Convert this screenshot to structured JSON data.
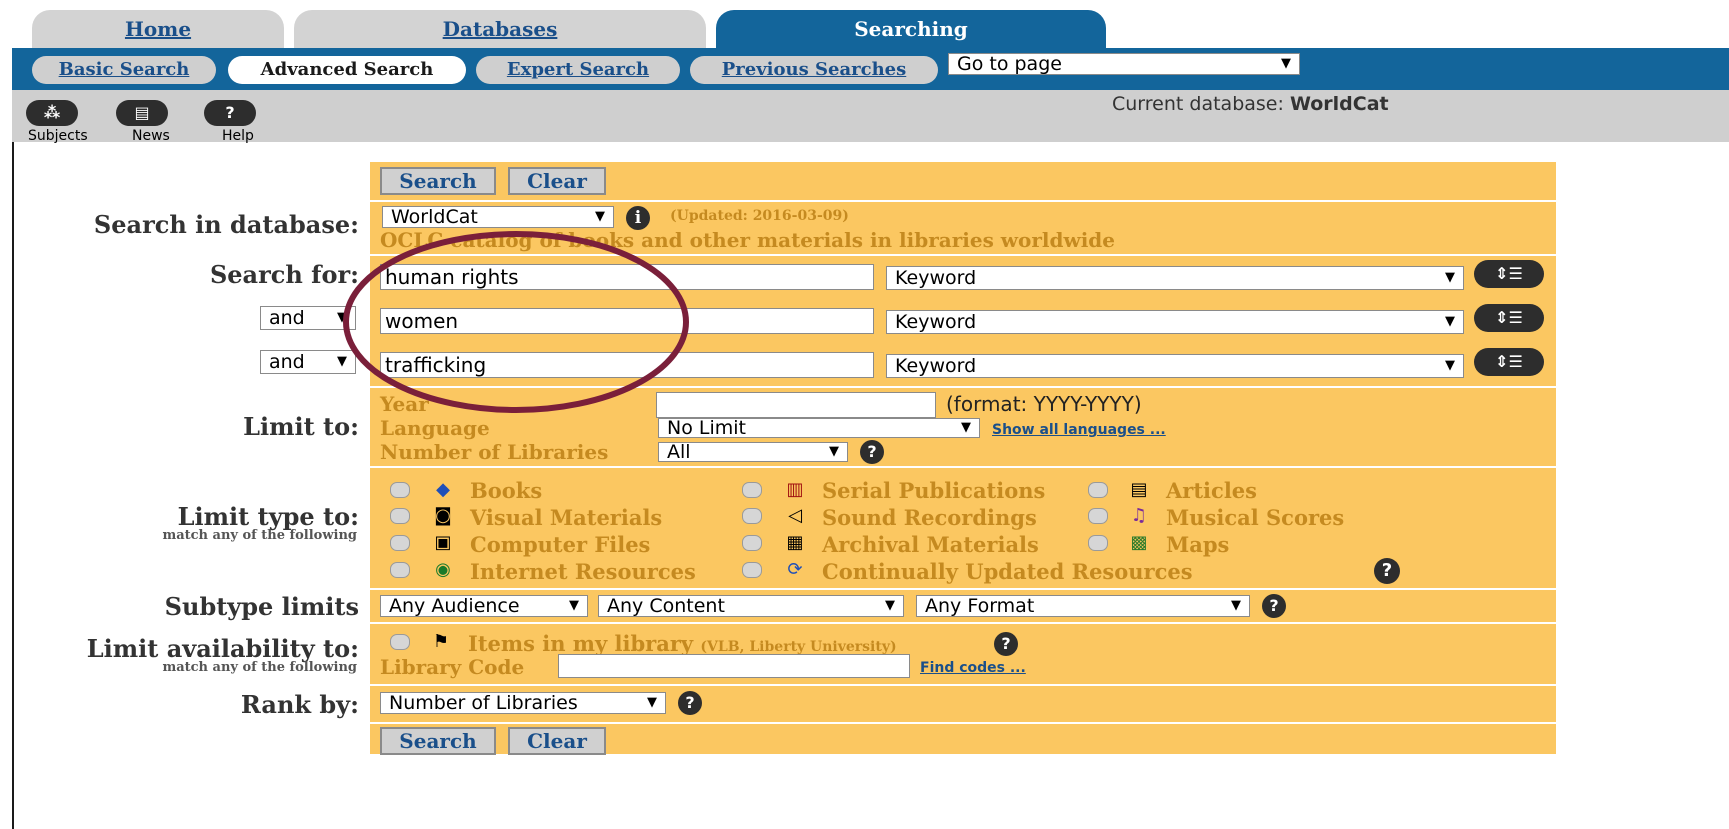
{
  "tabs": {
    "home": "Home",
    "databases": "Databases",
    "searching": "Searching"
  },
  "subtabs": {
    "basic": "Basic Search",
    "advanced": "Advanced Search",
    "expert": "Expert Search",
    "previous": "Previous Searches"
  },
  "goto_page": "Go to page",
  "toolbar": {
    "subjects": "Subjects",
    "news": "News",
    "help": "Help",
    "current_db_label": "Current database:",
    "current_db": "WorldCat"
  },
  "buttons": {
    "search": "Search",
    "clear": "Clear"
  },
  "labels": {
    "search_in_database": "Search in database:",
    "search_for": "Search for:",
    "limit_to": "Limit to:",
    "limit_type_to": "Limit type to:",
    "match_any": "match any of the following",
    "subtype_limits": "Subtype limits",
    "limit_availability_to": "Limit availability to:",
    "rank_by": "Rank by:"
  },
  "database": {
    "selected": "WorldCat",
    "updated": "(Updated: 2016-03-09)",
    "description": "OCLC catalog of books and other materials in libraries worldwide"
  },
  "search_rows": [
    {
      "operator": "",
      "term": "human rights",
      "index": "Keyword"
    },
    {
      "operator": "and",
      "term": "women",
      "index": "Keyword"
    },
    {
      "operator": "and",
      "term": "trafficking",
      "index": "Keyword"
    }
  ],
  "limits": {
    "year_label": "Year",
    "year_value": "",
    "year_format": "(format: YYYY-YYYY)",
    "language_label": "Language",
    "language_value": "No Limit",
    "show_all_languages": "Show all languages ...",
    "num_libraries_label": "Number of Libraries",
    "num_libraries_value": "All"
  },
  "types": [
    {
      "label": "Books",
      "icon": "book-icon"
    },
    {
      "label": "Serial Publications",
      "icon": "serial-icon"
    },
    {
      "label": "Articles",
      "icon": "article-icon"
    },
    {
      "label": "Visual Materials",
      "icon": "camera-icon"
    },
    {
      "label": "Sound Recordings",
      "icon": "speaker-icon"
    },
    {
      "label": "Musical Scores",
      "icon": "music-score-icon"
    },
    {
      "label": "Computer Files",
      "icon": "floppy-disk-icon"
    },
    {
      "label": "Archival Materials",
      "icon": "archive-icon"
    },
    {
      "label": "Maps",
      "icon": "map-icon"
    },
    {
      "label": "Internet Resources",
      "icon": "globe-icon"
    },
    {
      "label": "Continually Updated Resources",
      "icon": "updated-resource-icon"
    }
  ],
  "subtype": {
    "audience": "Any Audience",
    "content": "Any Content",
    "format": "Any Format"
  },
  "availability": {
    "items_in_library": "Items in my library",
    "library_name": "(VLB, Liberty University)",
    "library_code_label": "Library Code",
    "library_code_value": "",
    "find_codes": "Find codes ..."
  },
  "rank_by": "Number of Libraries",
  "colors": {
    "panel": "#fbc761",
    "tab_active": "#13659b",
    "label_gold": "#c58a20",
    "link": "#1a4f8a",
    "annotation": "#7a1f3a"
  }
}
